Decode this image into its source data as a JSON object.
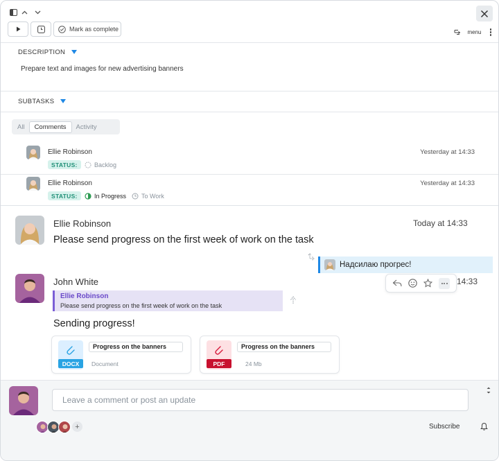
{
  "toolbar": {
    "mark_complete_label": "Mark as complete",
    "menu_label": "menu"
  },
  "description": {
    "label": "DESCRIPTION",
    "text": "Prepare text and images for new advertising banners"
  },
  "subtasks": {
    "label": "SUBTASKS"
  },
  "tabs": [
    {
      "label": "All"
    },
    {
      "label": "Comments"
    },
    {
      "label": "Activity"
    }
  ],
  "history": [
    {
      "author": "Ellie Robinson",
      "time": "Yesterday at 14:33",
      "status_label": "STATUS:",
      "status_value": "Backlog"
    },
    {
      "author": "Ellie Robinson",
      "time": "Yesterday at 14:33",
      "status_label": "STATUS:",
      "status_value": "In Progress",
      "status_to": "To Work"
    }
  ],
  "comments": [
    {
      "author": "Ellie Robinson",
      "time": "Today at 14:33",
      "text": "Please send progress on the first week of work on the task"
    },
    {
      "author": "John White",
      "time": "14:33",
      "quote_author": "Ellie Robinson",
      "quote_text": "Please send progress on the first week of work on the task",
      "text": "Sending progress!"
    }
  ],
  "reply": {
    "text": "Надсилаю прогрес!"
  },
  "files": [
    {
      "name": "Progress on the banners",
      "ext": "DOCX",
      "meta": "Document",
      "color": "#29a3e3",
      "tint": "#dcefff"
    },
    {
      "name": "Progress on the banners",
      "ext": "PDF",
      "meta": "24 Mb",
      "color": "#d6193a",
      "tint": "#fde0e3"
    }
  ],
  "footer": {
    "comment_placeholder": "Leave a comment or post an update",
    "subscribe_label": "Subscribe",
    "add_member": "+"
  },
  "colors": {
    "accent": "#1e88e5",
    "status_green": "#1f8f76",
    "quote_purple": "#6a49c9"
  }
}
